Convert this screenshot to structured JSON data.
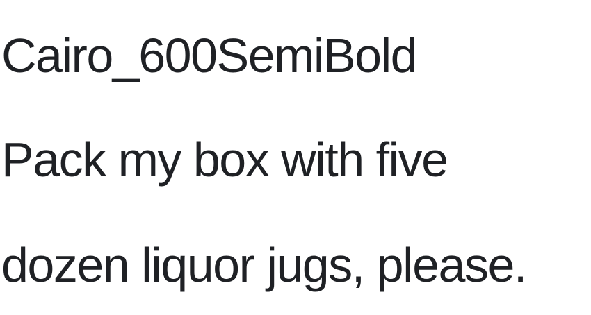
{
  "sample": {
    "font_name": "Cairo_600SemiBold",
    "lines": [
      "Pack my box with five",
      "dozen liquor jugs, please."
    ]
  },
  "colors": {
    "text": "#1f2125",
    "background": "#ffffff"
  }
}
